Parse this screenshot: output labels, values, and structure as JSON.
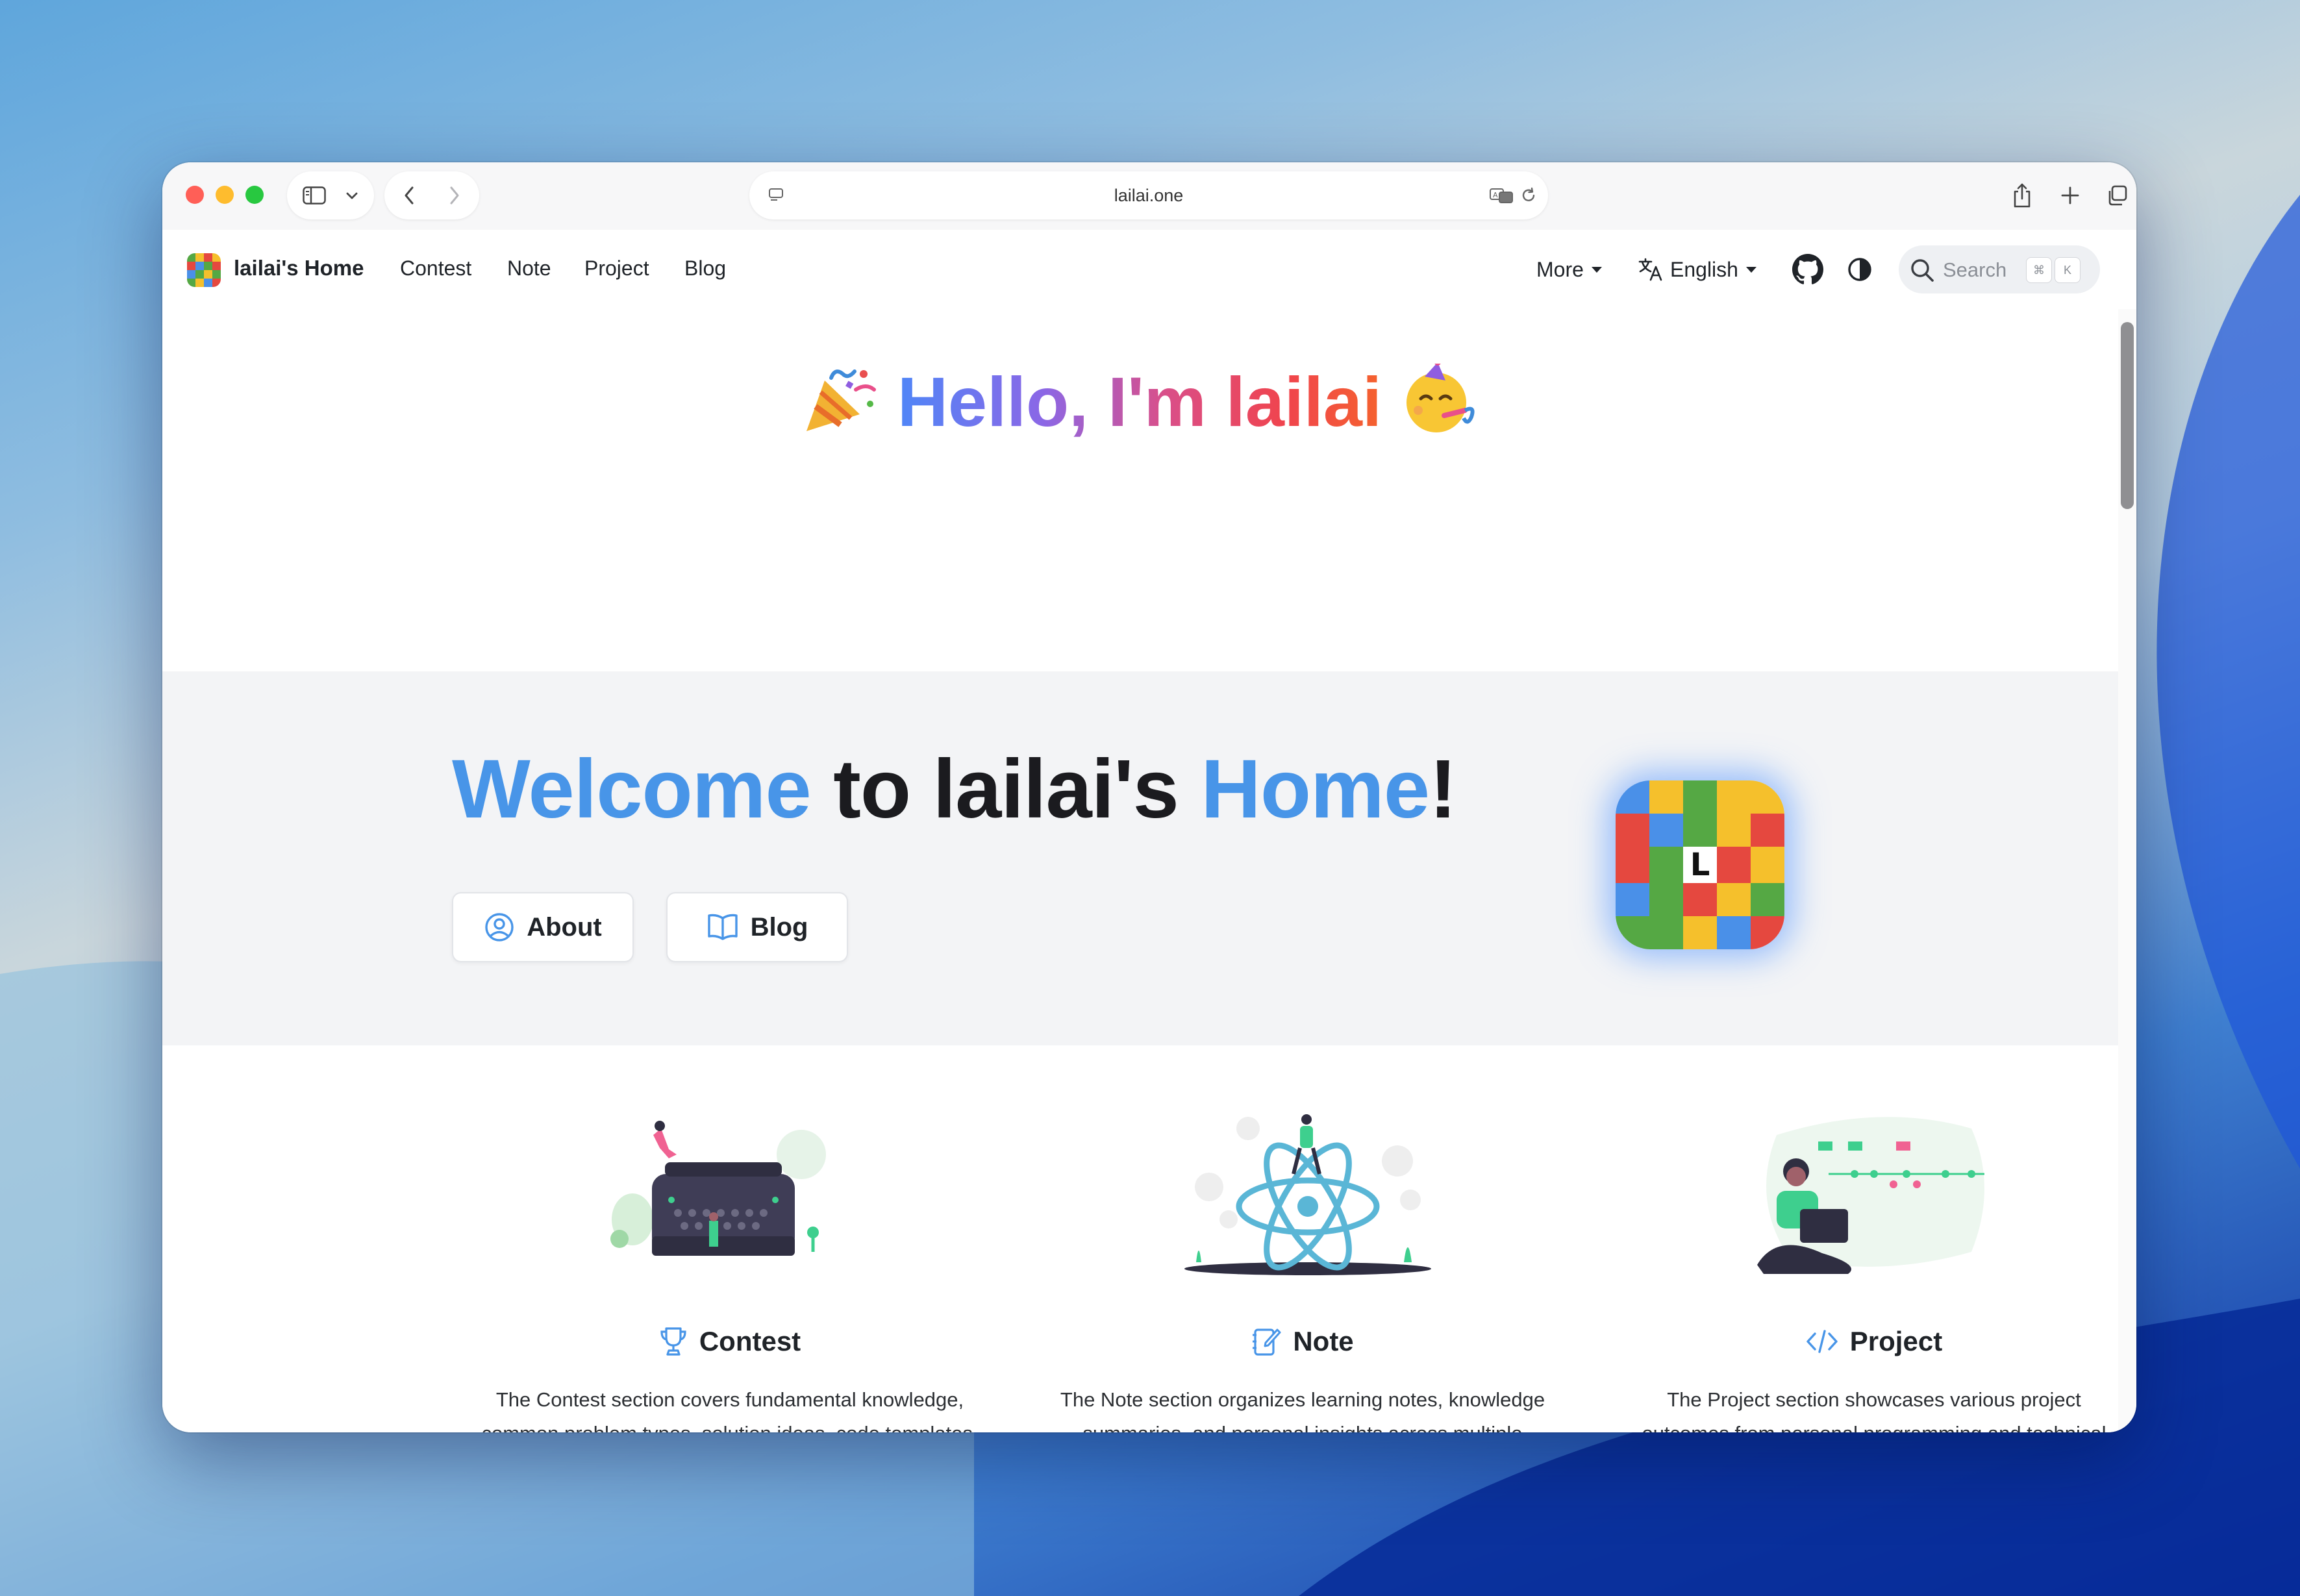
{
  "browser": {
    "url": "lailai.one"
  },
  "nav": {
    "site_title": "lailai's Home",
    "links": [
      "Contest",
      "Note",
      "Project",
      "Blog"
    ],
    "more_label": "More",
    "language_label": "English",
    "search_placeholder": "Search",
    "search_shortcut": [
      "⌘",
      "K"
    ]
  },
  "banner": {
    "hello_text": "Hello, I'm lailai"
  },
  "hero": {
    "welcome_part1": "Welcome",
    "welcome_part2": " to lailai's ",
    "welcome_part3": "Home",
    "welcome_part4": "!",
    "about_label": "About",
    "blog_label": "Blog",
    "logo_letter": "L"
  },
  "features": [
    {
      "title": "Contest",
      "description": "The Contest section covers fundamental knowledge, common problem types, solution ideas, code templates, and competition experience related to Olympiad in Informatics. It focuses on real contest environments, emphasizing algorithmic skills, programming practice, and overall"
    },
    {
      "title": "Note",
      "description": "The Note section organizes learning notes, knowledge summaries, and personal insights across multiple disciplines, including mathematics, programming, technology, and languages. It systematically presents key concepts and practical skills, reflecting the learning and understanding"
    },
    {
      "title": "Project",
      "description": "The Project section showcases various project outcomes from personal programming and technical practice, providing practical templates, tools, and relevant resources. It emphasizes real-world applications and exploration, combining technical learning, development practice, and"
    }
  ],
  "colors": {
    "accent_blue": "#4895e8",
    "hero_bg": "#f3f4f6",
    "logo_red": "#e5483f",
    "logo_yellow": "#f5c02c",
    "logo_green": "#55a844",
    "logo_blue": "#4a90e8"
  }
}
